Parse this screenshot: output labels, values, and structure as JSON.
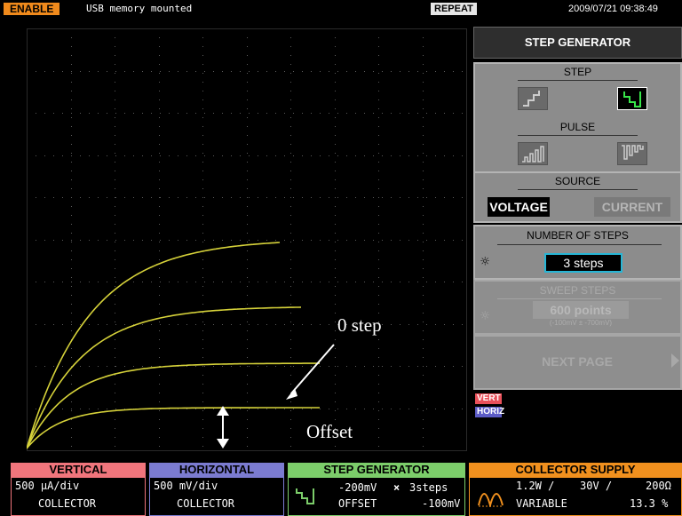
{
  "status": {
    "enable": "ENABLE",
    "usb": "USB memory mounted",
    "mode": "REPEAT",
    "datetime": "2009/07/21 09:38:49"
  },
  "annotations": {
    "step0": "0 step",
    "offset": "Offset"
  },
  "panel": {
    "title": "STEP GENERATOR",
    "step_label": "STEP",
    "pulse_label": "PULSE",
    "source_label": "SOURCE",
    "voltage": "VOLTAGE",
    "current": "CURRENT",
    "num_steps_label": "NUMBER OF STEPS",
    "num_steps_value": "3 steps",
    "sweep_label": "SWEEP STEPS",
    "sweep_value": "600 points",
    "sweep_range": "(-100mV ± -700mV)",
    "next_page": "NEXT PAGE"
  },
  "tags": {
    "vert": "VERT",
    "horiz": "HORIZ"
  },
  "bottom": {
    "vertical": {
      "title": "VERTICAL",
      "line1": "500 µA/div",
      "line2": "COLLECTOR"
    },
    "horizontal": {
      "title": "HORIZONTAL",
      "line1": "500 mV/div",
      "line2": "COLLECTOR"
    },
    "stepgen": {
      "title": "STEP GENERATOR",
      "v1": "-200mV",
      "times": "×",
      "steps": "3steps",
      "off_label": "OFFSET",
      "off_val": "-100mV"
    },
    "collector": {
      "title": "COLLECTOR SUPPLY",
      "power": "1.2W /",
      "volt": "30V /",
      "res": "200Ω",
      "mode": "VARIABLE",
      "pct": "13.3 %"
    }
  },
  "colors": {
    "vertical": "#f0757c",
    "horizontal": "#7b7bd0",
    "stepgen": "#7ccd6a",
    "collector": "#f0901e",
    "trace": "#d6d23a"
  }
}
